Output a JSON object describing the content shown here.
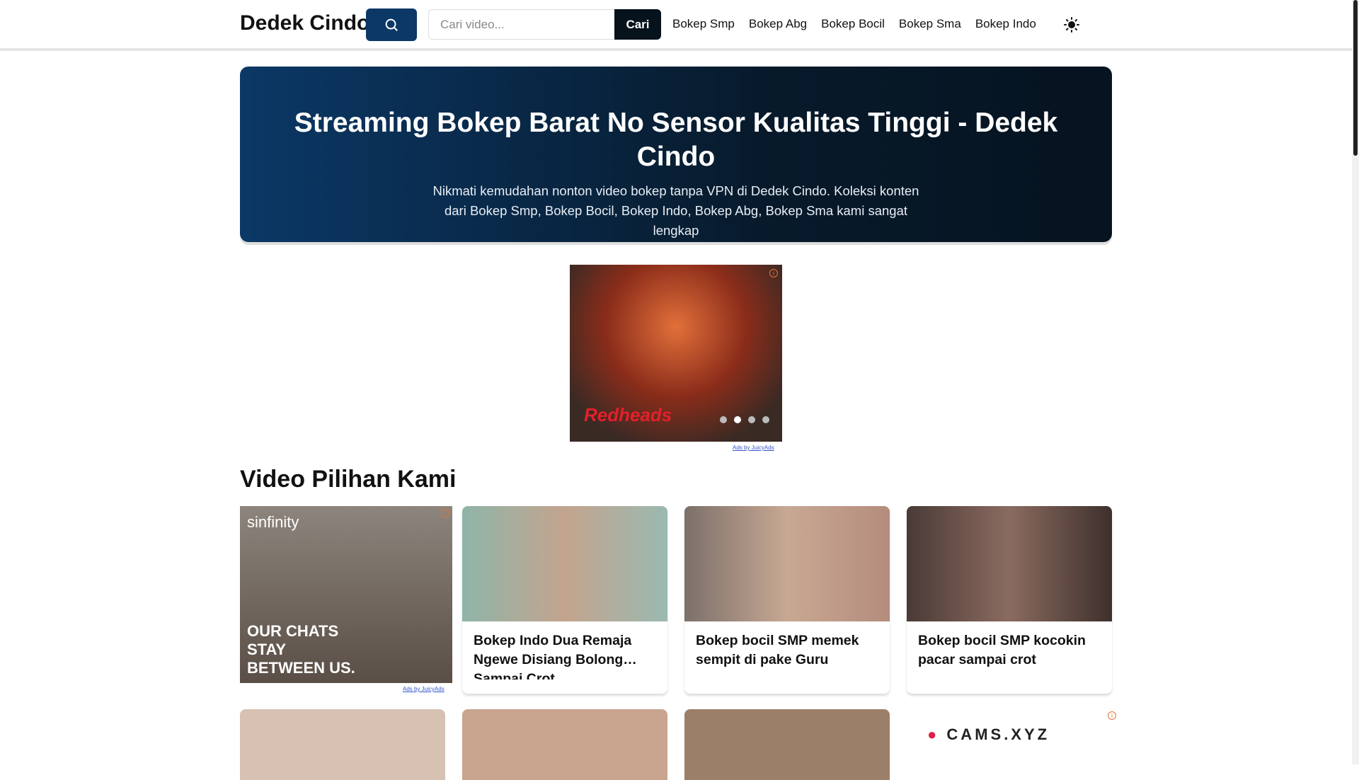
{
  "header": {
    "logo": "Dedek Cindo",
    "search_placeholder": "Cari video...",
    "search_button": "Cari",
    "nav": [
      "Bokep Smp",
      "Bokep Abg",
      "Bokep Bocil",
      "Bokep Sma",
      "Bokep Indo"
    ]
  },
  "hero": {
    "title": "Streaming Bokep Barat No Sensor Kualitas Tinggi - Dedek Cindo",
    "subtitle": "Nikmati kemudahan nonton video bokep tanpa VPN di Dedek Cindo. Koleksi konten dari Bokep Smp, Bokep Bocil, Bokep Indo, Bokep Abg, Bokep Sma kami sangat lengkap"
  },
  "ads": {
    "banner_brand": "Redheads",
    "ads_by": "Ads by JuicyAds",
    "sinfinity": "sinfinity",
    "sinfinity_tag": "OUR CHATS STAY BETWEEN US.",
    "cams": "CAMS.XYZ"
  },
  "section_title": "Video Pilihan Kami",
  "videos": [
    {
      "title": "Bokep Indo Dua Remaja Ngewe Disiang Bolong Sampai Crot"
    },
    {
      "title": "Bokep bocil SMP memek sempit di pake Guru"
    },
    {
      "title": "Bokep bocil SMP kocokin pacar sampai crot"
    }
  ],
  "colors": {
    "accent": "#0b3866",
    "dark": "#06121c"
  }
}
